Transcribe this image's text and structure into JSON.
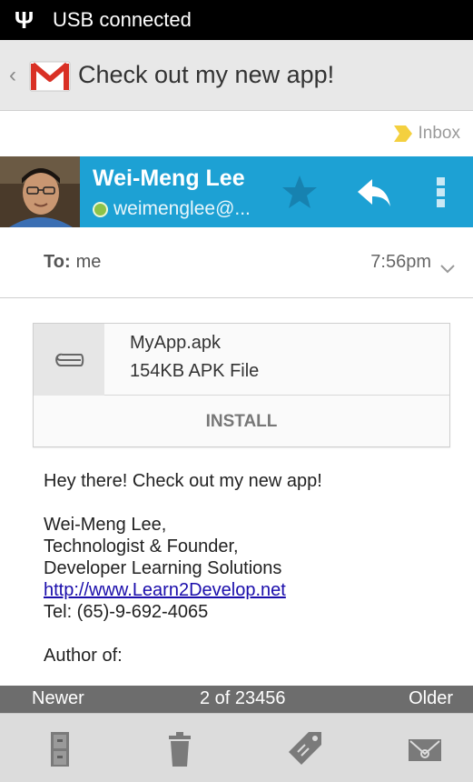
{
  "status_bar": {
    "usb_icon": "usb-icon",
    "text": "USB connected"
  },
  "action_bar": {
    "back_icon": "chevron-left-icon",
    "app_icon": "gmail-icon",
    "title": "Check out my new app!"
  },
  "label": {
    "icon": "label-tag-icon",
    "text": "Inbox",
    "color": "#f4d03f"
  },
  "sender": {
    "name": "Wei-Meng Lee",
    "email": "weimenglee@...",
    "presence_color": "#8bc34a",
    "header_color": "#1da1d4",
    "actions": [
      "star-icon",
      "reply-icon",
      "overflow-menu-icon"
    ]
  },
  "recipient": {
    "label": "To:",
    "value": "me",
    "time": "7:56pm"
  },
  "attachment": {
    "icon": "paperclip-icon",
    "name": "MyApp.apk",
    "size": "154KB APK File",
    "action": "INSTALL"
  },
  "message": {
    "greeting": "Hey there! Check out my new app!",
    "signature": [
      "Wei-Meng Lee,",
      "Technologist & Founder,",
      "Developer Learning Solutions"
    ],
    "link": "http://www.Learn2Develop.net",
    "tel": "Tel: (65)-9-692-4065",
    "author": "Author of:"
  },
  "navigation": {
    "newer": "Newer",
    "position": "2 of 23456",
    "older": "Older"
  },
  "toolbar": {
    "icons": [
      "archive-icon",
      "delete-icon",
      "labels-icon",
      "mark-unread-icon"
    ]
  }
}
